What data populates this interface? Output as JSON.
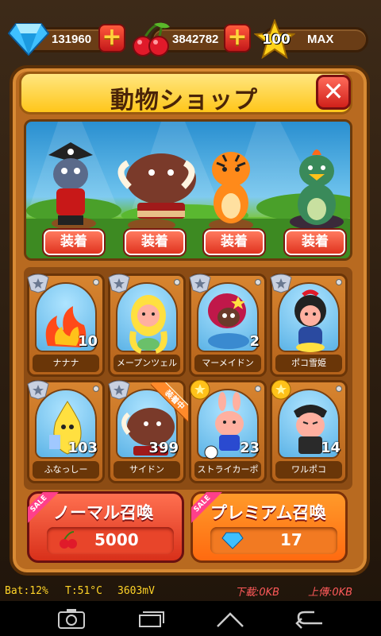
{
  "currency": {
    "gems": "131960",
    "cherries": "3842782",
    "level": "100",
    "level_state": "MAX"
  },
  "shop": {
    "title": "動物ショップ",
    "equip_label": "装着",
    "equipped_tag": "装着中",
    "stage": [
      {
        "name": "pirate-wolf"
      },
      {
        "name": "boar"
      },
      {
        "name": "tiger"
      },
      {
        "name": "green-bird"
      }
    ],
    "cards": [
      {
        "name": "ナナナ",
        "level": "10",
        "tier": "silver"
      },
      {
        "name": "メープンツェル",
        "level": "",
        "tier": "silver"
      },
      {
        "name": "マーメイドン",
        "level": "2",
        "tier": "silver"
      },
      {
        "name": "ポコ雪姫",
        "level": "",
        "tier": "silver"
      },
      {
        "name": "ふなっしー",
        "level": "103",
        "tier": "silver"
      },
      {
        "name": "サイドン",
        "level": "399",
        "tier": "silver",
        "equipped": true
      },
      {
        "name": "ストライカーポコ",
        "level": "23",
        "tier": "gold"
      },
      {
        "name": "ワルポコ",
        "level": "14",
        "tier": "gold"
      }
    ]
  },
  "summon": {
    "sale": "SALE",
    "normal_label": "ノーマル召喚",
    "normal_cost": "5000",
    "premium_label": "プレミアム召喚",
    "premium_cost": "17"
  },
  "status": {
    "battery": "Bat:12%",
    "temp": "T:51°C",
    "voltage": "3603mV",
    "download": "下載:0KB",
    "upload": "上傳:0KB"
  },
  "colors": {
    "panel": "#b86a20",
    "title_yellow": "#ffc61a",
    "button_red": "#e0331f",
    "premium_orange": "#ff6a10"
  }
}
